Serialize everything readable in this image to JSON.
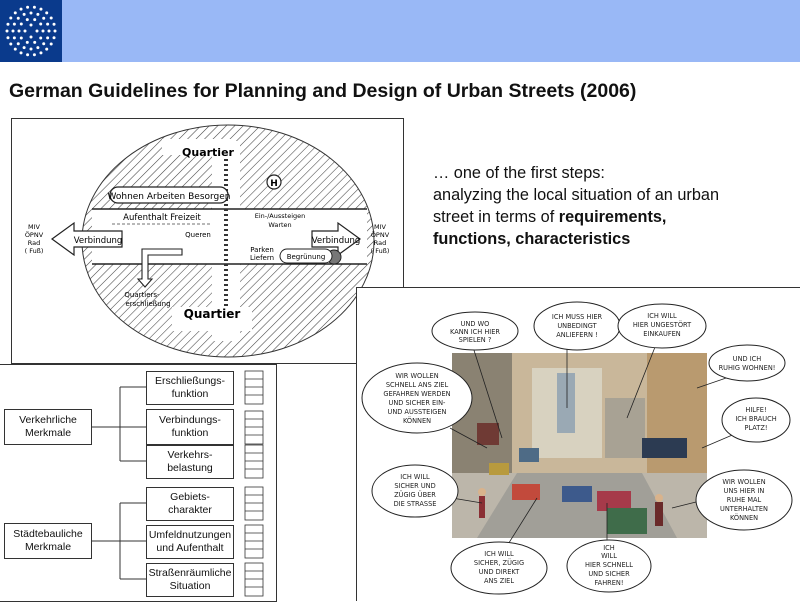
{
  "header": {
    "logo": "ring-of-stars-logo"
  },
  "slide": {
    "title": "German Guidelines for Planning and Design of Urban Streets (2006)",
    "caption": {
      "line1": "… one of the first steps:",
      "line2": "analyzing the local situation of an urban",
      "line3_plain": "street in terms of ",
      "line3_bold": "requirements,",
      "line4_bold": "functions, characteristics"
    }
  },
  "diagram": {
    "quartier_top": "Quartier",
    "quartier_bottom": "Quartier",
    "wohnen": "Wohnen  Arbeiten  Besorgen",
    "aufenthalt": "Aufenthalt  Freizeit",
    "verbindung_left": "Verbindung",
    "verbindung_right": "Verbindung",
    "miv_left": [
      "MIV",
      "ÖPNV",
      "Rad",
      "( Fuß)"
    ],
    "miv_right": [
      "MIV",
      "ÖPNV",
      "Rad",
      "( Fuß)"
    ],
    "haltestelle": "H",
    "einsteigen": [
      "Ein-/Aussteigen",
      "Warten"
    ],
    "queren": "Queren",
    "parken": [
      "Parken",
      "Liefern"
    ],
    "begruenung": "Begrünung",
    "quartierserschliessung": [
      "Quartiers-",
      "erschließung"
    ]
  },
  "table": {
    "groups": [
      {
        "label": [
          "Verkehrliche",
          "Merkmale"
        ]
      },
      {
        "label": [
          "Städtebauliche",
          "Merkmale"
        ]
      }
    ],
    "items": [
      [
        "Erschließungs-",
        "funktion"
      ],
      [
        "Verbindungs-",
        "funktion"
      ],
      [
        "Verkehrs-",
        "belastung"
      ],
      [
        "Gebiets-",
        "charakter"
      ],
      [
        "Umfeldnutzungen",
        "und Aufenthalt"
      ],
      [
        "Straßenräumliche",
        "Situation"
      ]
    ]
  },
  "sketch": {
    "bubbles": [
      [
        "UND WO",
        "KANN ICH HIER",
        "SPIELEN ?"
      ],
      [
        "ICH MUSS HIER",
        "UNBEDINGT",
        "ANLIEFERN !"
      ],
      [
        "ICH WILL",
        "HIER UNGESTÖRT",
        "EINKAUFEN"
      ],
      [
        "UND ICH",
        "RUHIG WOHNEN!"
      ],
      [
        "WIR WOLLEN",
        "SCHNELL ANS ZIEL",
        "GEFAHREN WERDEN",
        "UND SICHER EIN-",
        "UND AUSSTEIGEN",
        "KÖNNEN"
      ],
      [
        "HILFE!",
        "ICH BRAUCH",
        "PLATZ!"
      ],
      [
        "ICH WILL",
        "SICHER UND",
        "ZÜGIG ÜBER",
        "DIE STRASSE"
      ],
      [
        "WIR WOLLEN",
        "UNS HIER IN",
        "RUHE MAL",
        "UNTERHALTEN",
        "KÖNNEN"
      ],
      [
        "ICH WILL",
        "SICHER, ZÜGIG",
        "UND DIREKT",
        "ANS ZIEL"
      ],
      [
        "ICH",
        "WILL",
        "HIER SCHNELL",
        "UND SICHER",
        "FAHREN!"
      ]
    ]
  }
}
